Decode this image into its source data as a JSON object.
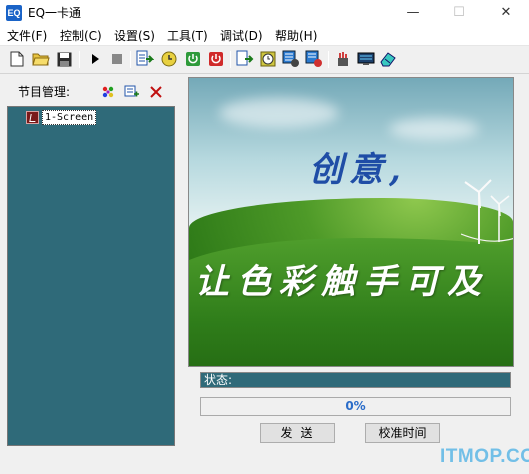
{
  "window": {
    "title": "EQ一卡通",
    "icon": "eq-app-icon",
    "controls": {
      "minimize": "—",
      "maximize": "☐",
      "close": "✕"
    }
  },
  "menu": {
    "items": [
      "文件(F)",
      "控制(C)",
      "设置(S)",
      "工具(T)",
      "调试(D)",
      "帮助(H)"
    ]
  },
  "toolbar": {
    "icons": [
      "new-file-icon",
      "open-folder-icon",
      "save-icon",
      "play-icon",
      "stop-icon",
      "send-program-icon",
      "clock-icon",
      "power-on-icon",
      "power-off-icon",
      "export-icon",
      "time-sync-icon",
      "screen-settings-icon",
      "screen-clear-icon",
      "tools-icon",
      "display-icon",
      "eraser-icon"
    ]
  },
  "left_panel": {
    "title": "节目管理:",
    "tools": [
      "colorful-add-icon",
      "screen-add-icon",
      "delete-icon"
    ],
    "tree": [
      {
        "label": "1-Screen"
      }
    ]
  },
  "preview": {
    "slogan_top": "创意,",
    "slogan_bottom": "让色彩触手可及"
  },
  "status": {
    "label": "状态:"
  },
  "progress": {
    "value": 0,
    "text": "0%"
  },
  "buttons": {
    "send": "发送",
    "calibrate_time": "校准时间"
  },
  "watermark": "ITMOP.COM",
  "colors": {
    "panel_teal": "#2f6a79",
    "slogan_blue": "#1f4da6",
    "progress_text": "#2a6cc9",
    "watermark": "#5db7e6"
  }
}
